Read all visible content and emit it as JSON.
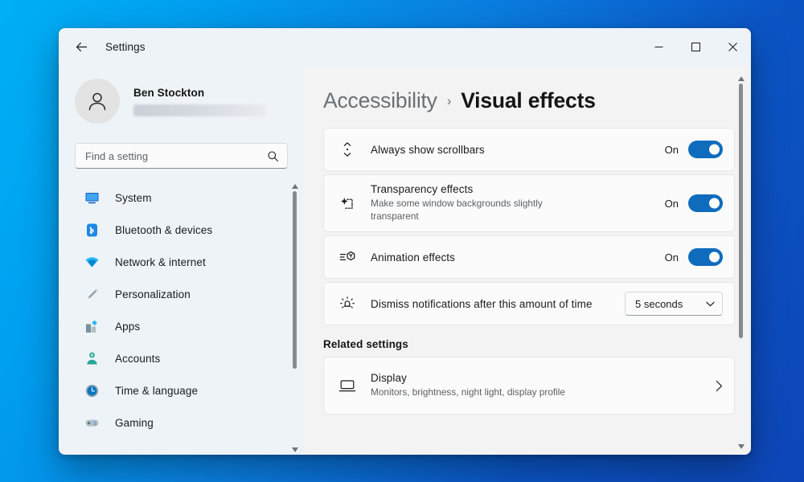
{
  "titlebar": {
    "back_icon": "arrow-left-icon",
    "title": "Settings",
    "minimize_label": "Minimize",
    "maximize_label": "Maximize",
    "close_label": "Close"
  },
  "sidebar": {
    "account": {
      "name": "Ben Stockton",
      "email_redacted": true,
      "avatar_icon": "person-icon"
    },
    "search": {
      "value": "",
      "placeholder": "Find a setting",
      "icon": "search-icon"
    },
    "items": [
      {
        "label": "System",
        "icon": "system-icon"
      },
      {
        "label": "Bluetooth & devices",
        "icon": "bluetooth-icon"
      },
      {
        "label": "Network & internet",
        "icon": "network-icon"
      },
      {
        "label": "Personalization",
        "icon": "brush-icon"
      },
      {
        "label": "Apps",
        "icon": "apps-icon"
      },
      {
        "label": "Accounts",
        "icon": "accounts-icon"
      },
      {
        "label": "Time & language",
        "icon": "clock-icon"
      },
      {
        "label": "Gaming",
        "icon": "gamepad-icon"
      }
    ]
  },
  "main": {
    "breadcrumb": {
      "parent": "Accessibility",
      "separator": "›",
      "current": "Visual effects"
    },
    "settings": [
      {
        "title": "Always show scrollbars",
        "subtitle": "",
        "icon": "scrollbar-icon",
        "control": "toggle",
        "state_label": "On",
        "state": true
      },
      {
        "title": "Transparency effects",
        "subtitle": "Make some window backgrounds slightly transparent",
        "icon": "transparency-icon",
        "control": "toggle",
        "state_label": "On",
        "state": true
      },
      {
        "title": "Animation effects",
        "subtitle": "",
        "icon": "animation-icon",
        "control": "toggle",
        "state_label": "On",
        "state": true
      },
      {
        "title": "Dismiss notifications after this amount of time",
        "subtitle": "",
        "icon": "notification-timer-icon",
        "control": "dropdown",
        "selected": "5 seconds"
      }
    ],
    "related": {
      "heading": "Related settings",
      "items": [
        {
          "title": "Display",
          "subtitle": "Monitors, brightness, night light, display profile",
          "icon": "monitor-icon",
          "chevron": "chevron-right-icon"
        }
      ]
    }
  },
  "colors": {
    "accent": "#0f6cbd",
    "window_bg": "#f3f3f3",
    "sidebar_bg": "#eef3f7",
    "card_bg": "#fbfbfb",
    "desktop_start": "#00b0f5",
    "desktop_end": "#0d45b8"
  }
}
